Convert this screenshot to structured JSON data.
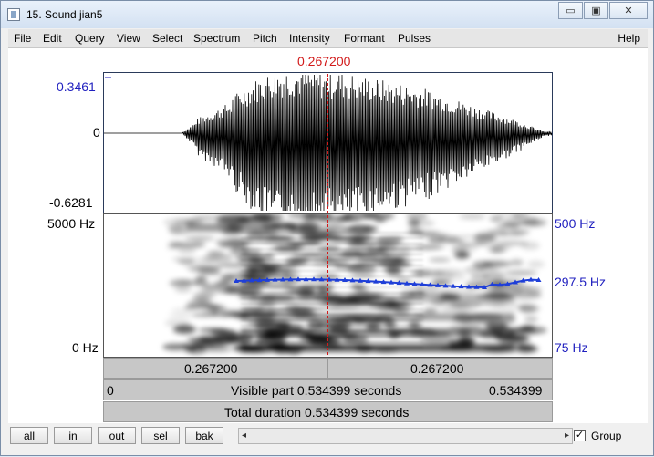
{
  "window": {
    "title": "15. Sound jian5",
    "buttons": {
      "minimize": "▭",
      "maximize": "▣",
      "close": "✕"
    }
  },
  "menu": {
    "items": [
      "File",
      "Edit",
      "Query",
      "View",
      "Select",
      "Spectrum",
      "Pitch",
      "Intensity",
      "Formant",
      "Pulses"
    ],
    "help": "Help"
  },
  "cursor_time": "0.267200",
  "waveform": {
    "max_label": "0.3461",
    "zero_label": "0",
    "min_label": "-0.6281"
  },
  "spectrogram": {
    "top_freq_label": "5000 Hz",
    "bottom_freq_label": "0 Hz"
  },
  "pitch": {
    "top_label": "500 Hz",
    "mid_label": "297.5 Hz",
    "bottom_label": "75 Hz"
  },
  "time_bar": {
    "left_segment": "0.267200",
    "right_segment": "0.267200",
    "visible_start": "0",
    "visible_text": "Visible part 0.534399 seconds",
    "visible_end": "0.534399",
    "total_text": "Total duration 0.534399 seconds"
  },
  "toolbar": {
    "buttons": [
      "all",
      "in",
      "out",
      "sel",
      "bak"
    ],
    "group_label": "Group",
    "group_checked": true,
    "scroll_left": "◂",
    "scroll_right": "▸"
  },
  "colors": {
    "cursor": "#d21a1a",
    "pitch_line": "#1f3fd8",
    "label_blue": "#1f1fbf"
  }
}
